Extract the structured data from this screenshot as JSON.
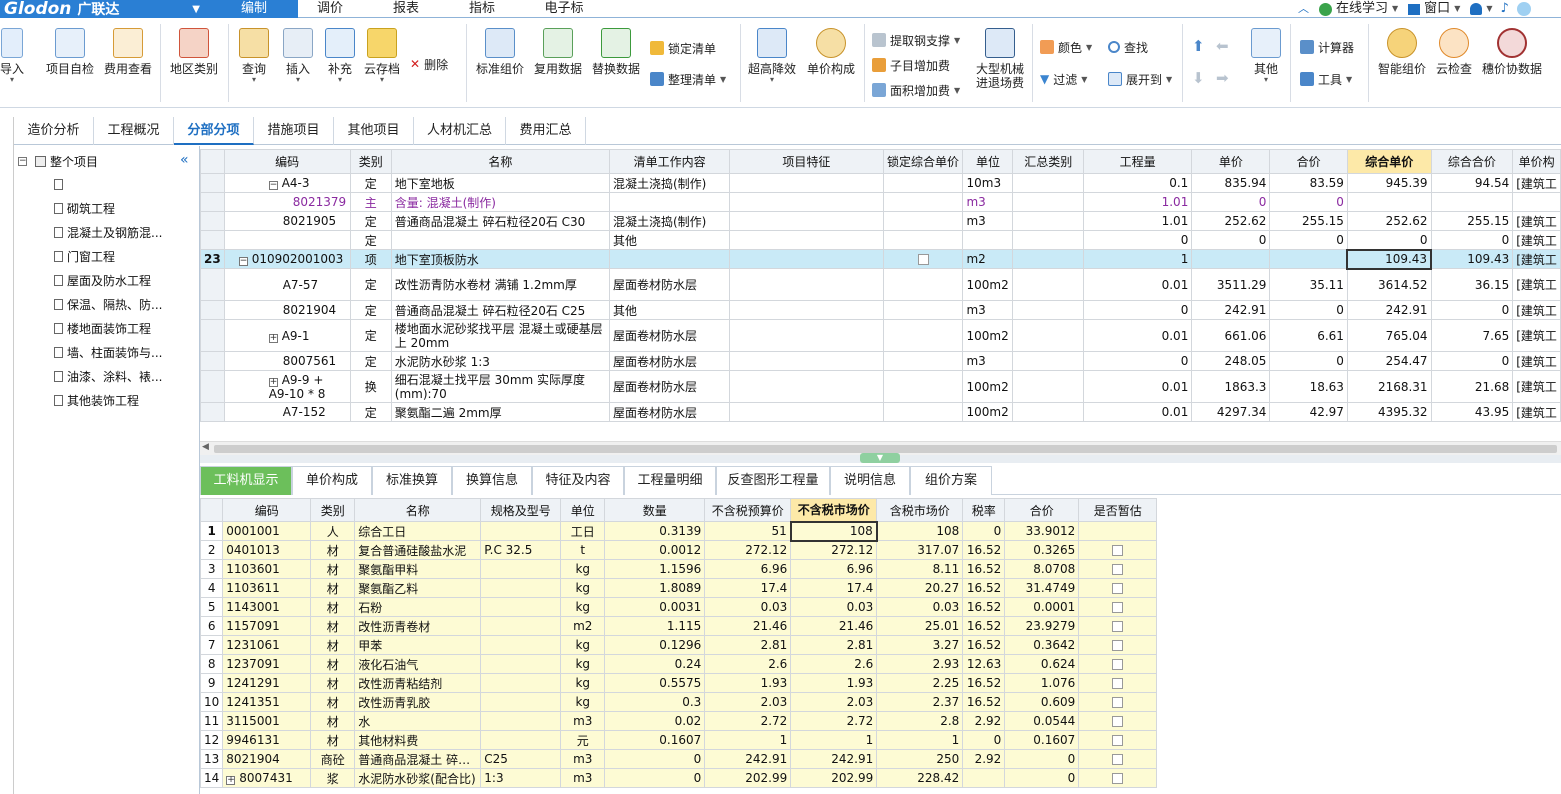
{
  "app": {
    "brand": "Glodon",
    "brand_cn": "广联达"
  },
  "menu": [
    "编制",
    "调价",
    "报表",
    "指标",
    "电子标"
  ],
  "right_tools": {
    "learn": "在线学习",
    "window": "窗口"
  },
  "ribbon": {
    "big": [
      "导入",
      "项目自检",
      "费用查看",
      "地区类别",
      "查询",
      "插入",
      "补充",
      "云存档",
      "标准组价",
      "复用数据",
      "替换数据",
      "超高降效",
      "单价构成",
      "大型机械",
      "进退场费",
      "其他",
      "智能组价",
      "云检查",
      "穗价协数据"
    ],
    "small": [
      "删除",
      "锁定清单",
      "整理清单",
      "提取钢支撑",
      "子目增加费",
      "面积增加费",
      "颜色",
      "查找",
      "过滤",
      "展开到",
      "计算器",
      "工具"
    ]
  },
  "view_tabs": [
    "造价分析",
    "工程概况",
    "分部分项",
    "措施项目",
    "其他项目",
    "人材机汇总",
    "费用汇总"
  ],
  "tree": {
    "root": "整个项目",
    "items": [
      "",
      "砌筑工程",
      "混凝土及钢筋混...",
      "门窗工程",
      "屋面及防水工程",
      "保温、隔热、防...",
      "楼地面装饰工程",
      "墙、柱面装饰与...",
      "油漆、涂料、裱...",
      "其他装饰工程"
    ]
  },
  "grid1": {
    "headers": [
      "编码",
      "类别",
      "名称",
      "清单工作内容",
      "项目特征",
      "锁定综合单价",
      "单位",
      "汇总类别",
      "工程量",
      "单价",
      "合价",
      "综合单价",
      "综合合价",
      "单价构"
    ],
    "rows": [
      {
        "rn": "",
        "code": "A4-3",
        "type": "定",
        "name": "地下室地板",
        "work": "混凝土浇捣(制作)",
        "unit": "10m3",
        "qty": "0.1",
        "price": "835.94",
        "total": "83.59",
        "uprice": "945.39",
        "utotal": "94.54",
        "cat": "[建筑工"
      },
      {
        "rn": "",
        "code": "8021379",
        "type": "主",
        "name": "含量: 混凝土(制作)",
        "work": "",
        "unit": "m3",
        "qty": "1.01",
        "price": "0",
        "total": "0",
        "uprice": "",
        "utotal": "",
        "cat": ""
      },
      {
        "rn": "",
        "code": "8021905",
        "type": "定",
        "name": "普通商品混凝土 碎石粒径20石 C30",
        "work": "混凝土浇捣(制作)",
        "unit": "m3",
        "qty": "1.01",
        "price": "252.62",
        "total": "255.15",
        "uprice": "252.62",
        "utotal": "255.15",
        "cat": "[建筑工"
      },
      {
        "rn": "",
        "code": "",
        "type": "定",
        "name": "",
        "work": "其他",
        "unit": "",
        "qty": "0",
        "price": "0",
        "total": "0",
        "uprice": "0",
        "utotal": "0",
        "cat": "[建筑工"
      },
      {
        "rn": "23",
        "code": "010902001003",
        "type": "项",
        "name": "地下室顶板防水",
        "work": "",
        "unit": "m2",
        "qty": "1",
        "price": "",
        "total": "",
        "uprice": "109.43",
        "utotal": "109.43",
        "cat": "[建筑工"
      },
      {
        "rn": "",
        "code": "A7-57",
        "type": "定",
        "name": "改性沥青防水卷材 满铺 1.2mm厚",
        "work": "屋面卷材防水层",
        "unit": "100m2",
        "qty": "0.01",
        "price": "3511.29",
        "total": "35.11",
        "uprice": "3614.52",
        "utotal": "36.15",
        "cat": "[建筑工"
      },
      {
        "rn": "",
        "code": "8021904",
        "type": "定",
        "name": "普通商品混凝土 碎石粒径20石 C25",
        "work": "其他",
        "unit": "m3",
        "qty": "0",
        "price": "242.91",
        "total": "0",
        "uprice": "242.91",
        "utotal": "0",
        "cat": "[建筑工"
      },
      {
        "rn": "",
        "code": "A9-1",
        "type": "定",
        "name": "楼地面水泥砂浆找平层 混凝土或硬基层上 20mm",
        "work": "屋面卷材防水层",
        "unit": "100m2",
        "qty": "0.01",
        "price": "661.06",
        "total": "6.61",
        "uprice": "765.04",
        "utotal": "7.65",
        "cat": "[建筑工"
      },
      {
        "rn": "",
        "code": "8007561",
        "type": "定",
        "name": "水泥防水砂浆 1:3",
        "work": "屋面卷材防水层",
        "unit": "m3",
        "qty": "0",
        "price": "248.05",
        "total": "0",
        "uprice": "254.47",
        "utotal": "0",
        "cat": "[建筑工"
      },
      {
        "rn": "",
        "code": "A9-9 + A9-10 * 8",
        "type": "换",
        "name": "细石混凝土找平层 30mm 实际厚度(mm):70",
        "work": "屋面卷材防水层",
        "unit": "100m2",
        "qty": "0.01",
        "price": "1863.3",
        "total": "18.63",
        "uprice": "2168.31",
        "utotal": "21.68",
        "cat": "[建筑工"
      },
      {
        "rn": "",
        "code": "A7-152",
        "type": "定",
        "name": "聚氨酯二遍 2mm厚",
        "work": "屋面卷材防水层",
        "unit": "100m2",
        "qty": "0.01",
        "price": "4297.34",
        "total": "42.97",
        "uprice": "4395.32",
        "utotal": "43.95",
        "cat": "[建筑工"
      }
    ]
  },
  "bottom_tabs": [
    "工料机显示",
    "单价构成",
    "标准换算",
    "换算信息",
    "特征及内容",
    "工程量明细",
    "反查图形工程量",
    "说明信息",
    "组价方案"
  ],
  "grid2": {
    "headers": [
      "",
      "编码",
      "类别",
      "名称",
      "规格及型号",
      "单位",
      "数量",
      "不含税预算价",
      "不含税市场价",
      "含税市场价",
      "税率",
      "合价",
      "是否暂估"
    ],
    "rows": [
      {
        "rn": "1",
        "code": "0001001",
        "type": "人",
        "name": "综合工日",
        "spec": "",
        "unit": "工日",
        "qty": "0.3139",
        "budget": "51",
        "market": "108",
        "taxed": "108",
        "rate": "0",
        "total": "33.9012"
      },
      {
        "rn": "2",
        "code": "0401013",
        "type": "材",
        "name": "复合普通硅酸盐水泥",
        "spec": "P.C 32.5",
        "unit": "t",
        "qty": "0.0012",
        "budget": "272.12",
        "market": "272.12",
        "taxed": "317.07",
        "rate": "16.52",
        "total": "0.3265"
      },
      {
        "rn": "3",
        "code": "1103601",
        "type": "材",
        "name": "聚氨酯甲料",
        "spec": "",
        "unit": "kg",
        "qty": "1.1596",
        "budget": "6.96",
        "market": "6.96",
        "taxed": "8.11",
        "rate": "16.52",
        "total": "8.0708"
      },
      {
        "rn": "4",
        "code": "1103611",
        "type": "材",
        "name": "聚氨酯乙料",
        "spec": "",
        "unit": "kg",
        "qty": "1.8089",
        "budget": "17.4",
        "market": "17.4",
        "taxed": "20.27",
        "rate": "16.52",
        "total": "31.4749"
      },
      {
        "rn": "5",
        "code": "1143001",
        "type": "材",
        "name": "石粉",
        "spec": "",
        "unit": "kg",
        "qty": "0.0031",
        "budget": "0.03",
        "market": "0.03",
        "taxed": "0.03",
        "rate": "16.52",
        "total": "0.0001"
      },
      {
        "rn": "6",
        "code": "1157091",
        "type": "材",
        "name": "改性沥青卷材",
        "spec": "",
        "unit": "m2",
        "qty": "1.115",
        "budget": "21.46",
        "market": "21.46",
        "taxed": "25.01",
        "rate": "16.52",
        "total": "23.9279"
      },
      {
        "rn": "7",
        "code": "1231061",
        "type": "材",
        "name": "甲苯",
        "spec": "",
        "unit": "kg",
        "qty": "0.1296",
        "budget": "2.81",
        "market": "2.81",
        "taxed": "3.27",
        "rate": "16.52",
        "total": "0.3642"
      },
      {
        "rn": "8",
        "code": "1237091",
        "type": "材",
        "name": "液化石油气",
        "spec": "",
        "unit": "kg",
        "qty": "0.24",
        "budget": "2.6",
        "market": "2.6",
        "taxed": "2.93",
        "rate": "12.63",
        "total": "0.624"
      },
      {
        "rn": "9",
        "code": "1241291",
        "type": "材",
        "name": "改性沥青粘结剂",
        "spec": "",
        "unit": "kg",
        "qty": "0.5575",
        "budget": "1.93",
        "market": "1.93",
        "taxed": "2.25",
        "rate": "16.52",
        "total": "1.076"
      },
      {
        "rn": "10",
        "code": "1241351",
        "type": "材",
        "name": "改性沥青乳胶",
        "spec": "",
        "unit": "kg",
        "qty": "0.3",
        "budget": "2.03",
        "market": "2.03",
        "taxed": "2.37",
        "rate": "16.52",
        "total": "0.609"
      },
      {
        "rn": "11",
        "code": "3115001",
        "type": "材",
        "name": "水",
        "spec": "",
        "unit": "m3",
        "qty": "0.02",
        "budget": "2.72",
        "market": "2.72",
        "taxed": "2.8",
        "rate": "2.92",
        "total": "0.0544"
      },
      {
        "rn": "12",
        "code": "9946131",
        "type": "材",
        "name": "其他材料费",
        "spec": "",
        "unit": "元",
        "qty": "0.1607",
        "budget": "1",
        "market": "1",
        "taxed": "1",
        "rate": "0",
        "total": "0.1607"
      },
      {
        "rn": "13",
        "code": "8021904",
        "type": "商砼",
        "name": "普通商品混凝土 碎…",
        "spec": "C25",
        "unit": "m3",
        "qty": "0",
        "budget": "242.91",
        "market": "242.91",
        "taxed": "250",
        "rate": "2.92",
        "total": "0"
      },
      {
        "rn": "14",
        "code": "8007431",
        "type": "浆",
        "name": "水泥防水砂浆(配合比)",
        "spec": "1:3",
        "unit": "m3",
        "qty": "0",
        "budget": "202.99",
        "market": "202.99",
        "taxed": "228.42",
        "rate": "",
        "total": "0"
      }
    ]
  },
  "colors": {
    "brand_blue": "#2a7fd4",
    "active_green": "#6cbf5b",
    "selected_row": "#c9eaf7",
    "highlight_header": "#fde9a8",
    "grid2_fill": "#fdfbd4"
  }
}
